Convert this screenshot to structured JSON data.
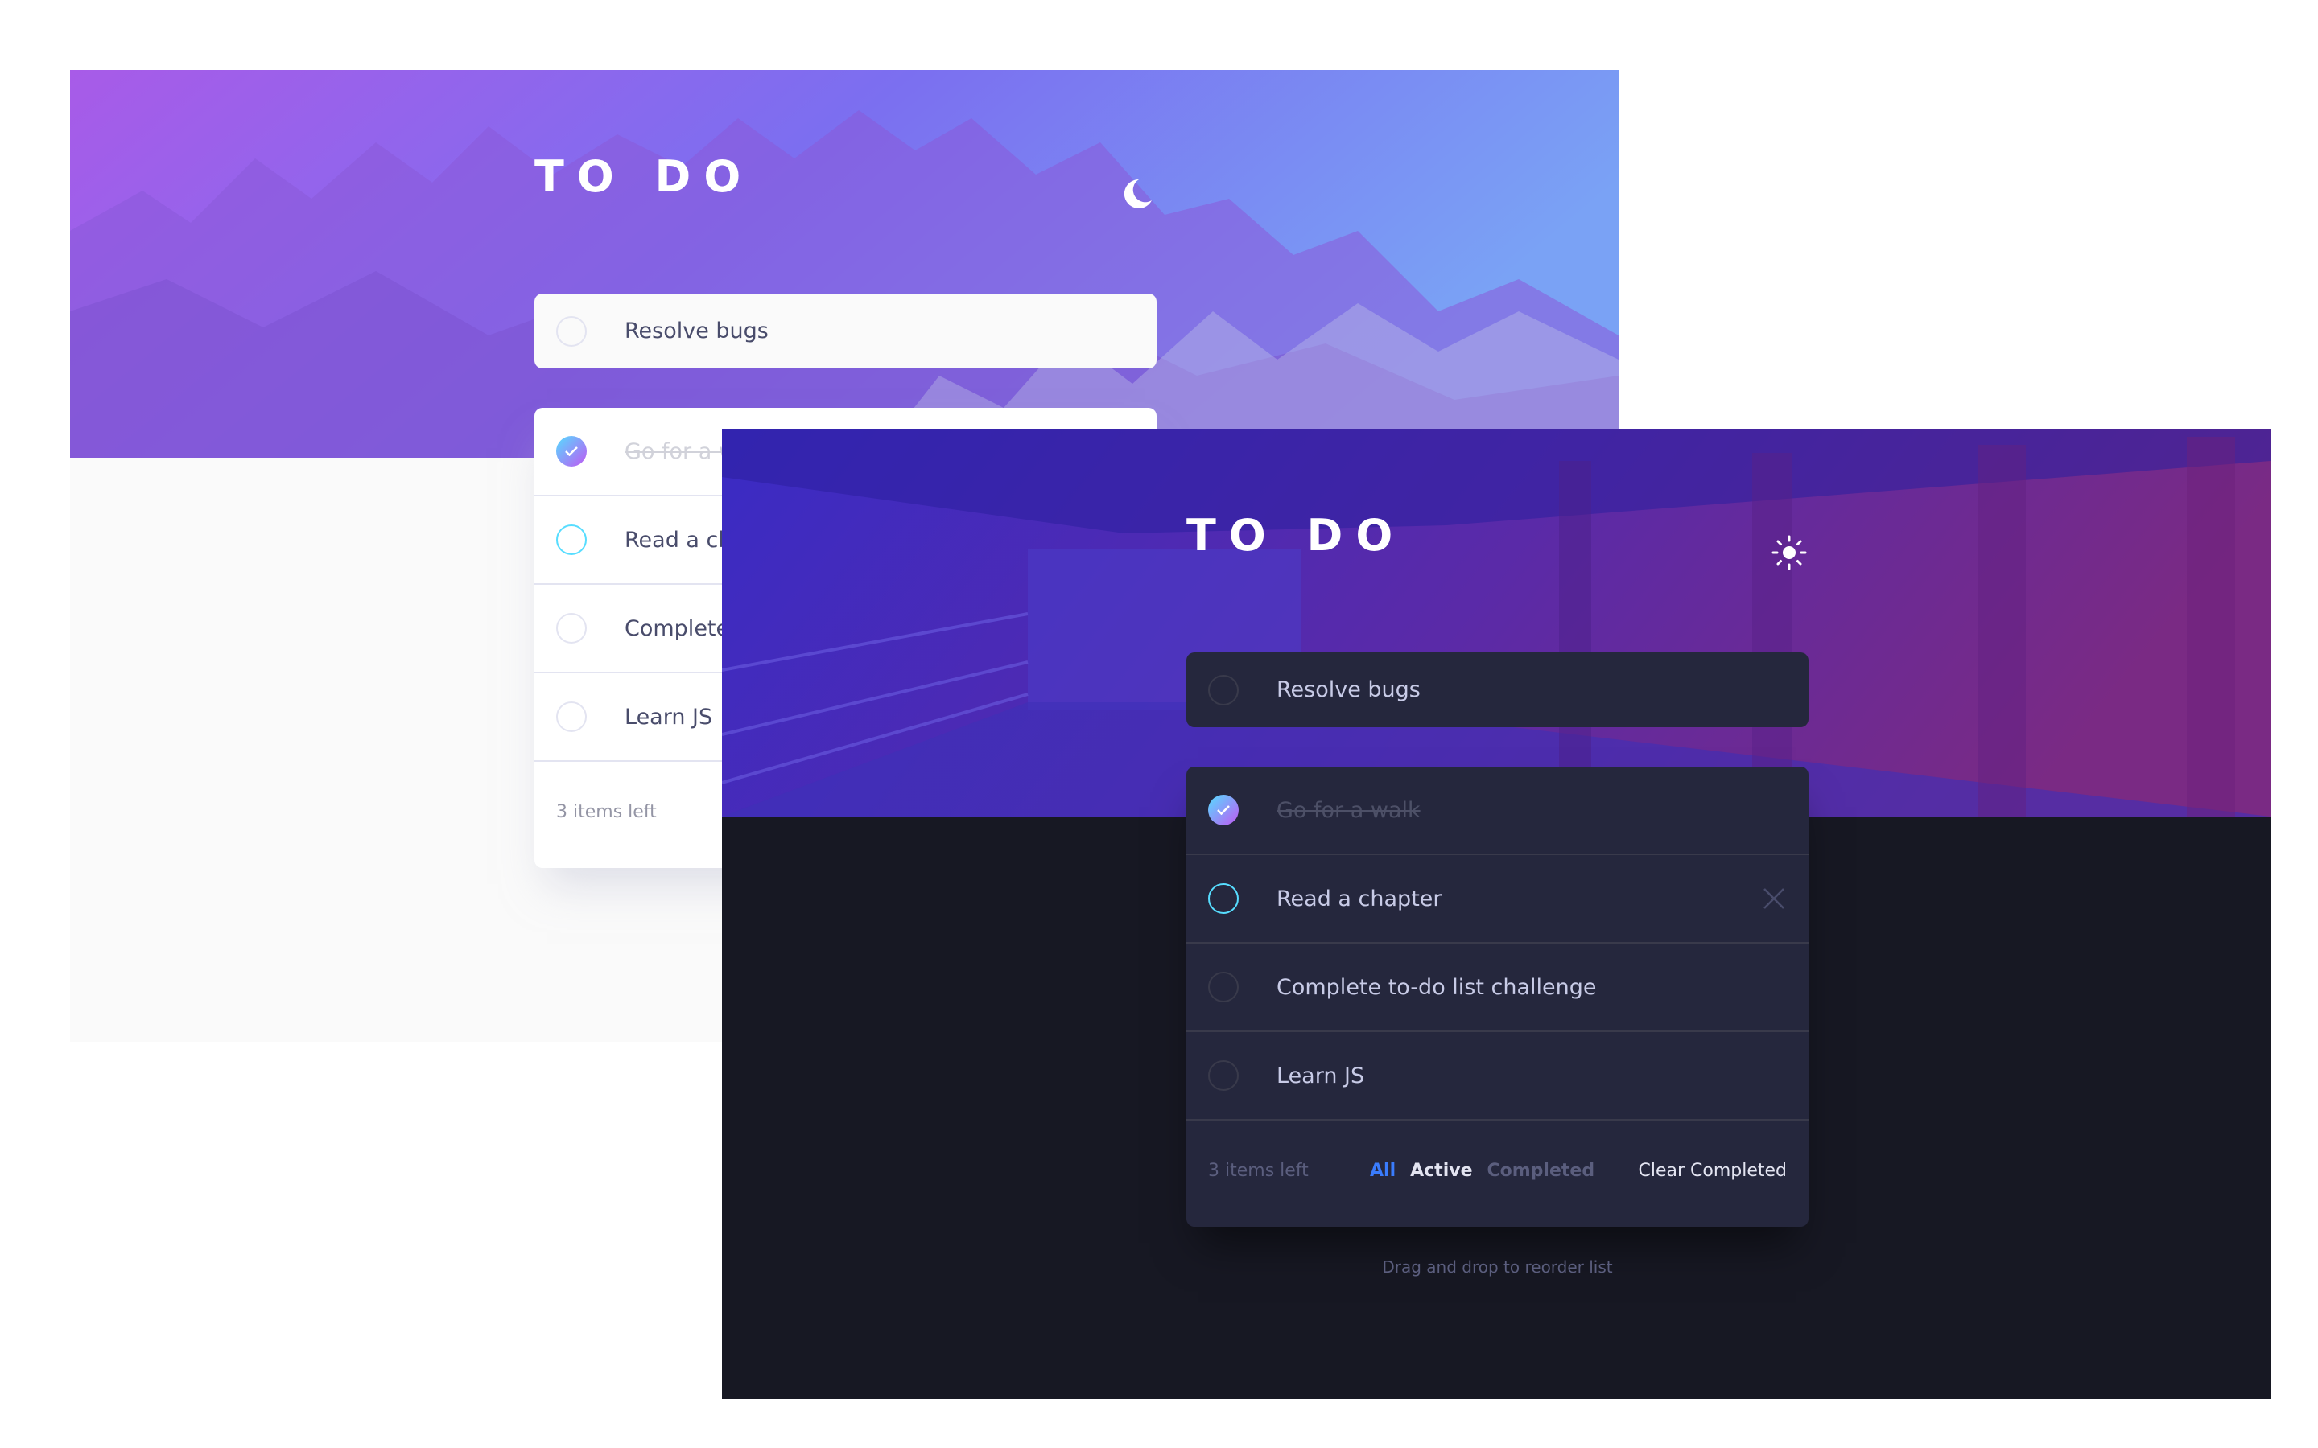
{
  "light_screen": {
    "title": "TO DO",
    "theme_toggle_icon": "moon-icon",
    "new_todo": {
      "value": "Resolve bugs"
    },
    "todos": [
      {
        "text": "Go for a walk",
        "completed": true
      },
      {
        "text": "Read a chapter",
        "completed": false
      },
      {
        "text": "Complete to-do list challenge",
        "completed": false
      },
      {
        "text": "Learn JS",
        "completed": false
      }
    ],
    "footer": {
      "items_left": "3 items left"
    }
  },
  "dark_screen": {
    "title": "TO DO",
    "theme_toggle_icon": "sun-icon",
    "new_todo": {
      "value": "Resolve bugs"
    },
    "todos": [
      {
        "text": "Go for a walk",
        "completed": true
      },
      {
        "text": "Read a chapter",
        "completed": false
      },
      {
        "text": "Complete to-do list challenge",
        "completed": false
      },
      {
        "text": "Learn JS",
        "completed": false
      }
    ],
    "footer": {
      "items_left": "3 items left",
      "filters": [
        {
          "label": "All",
          "state": "selected"
        },
        {
          "label": "Active",
          "state": "hover"
        },
        {
          "label": "Completed",
          "state": "default"
        }
      ],
      "clear_label": "Clear Completed"
    },
    "hint": "Drag and drop to reorder list"
  },
  "colors": {
    "check_gradient_start": "#55ddff",
    "check_gradient_end": "#c058f3",
    "selected_filter": "#3a7cfd",
    "light_bg": "#fafafa",
    "dark_bg": "#171823",
    "dark_card": "#25273d"
  }
}
